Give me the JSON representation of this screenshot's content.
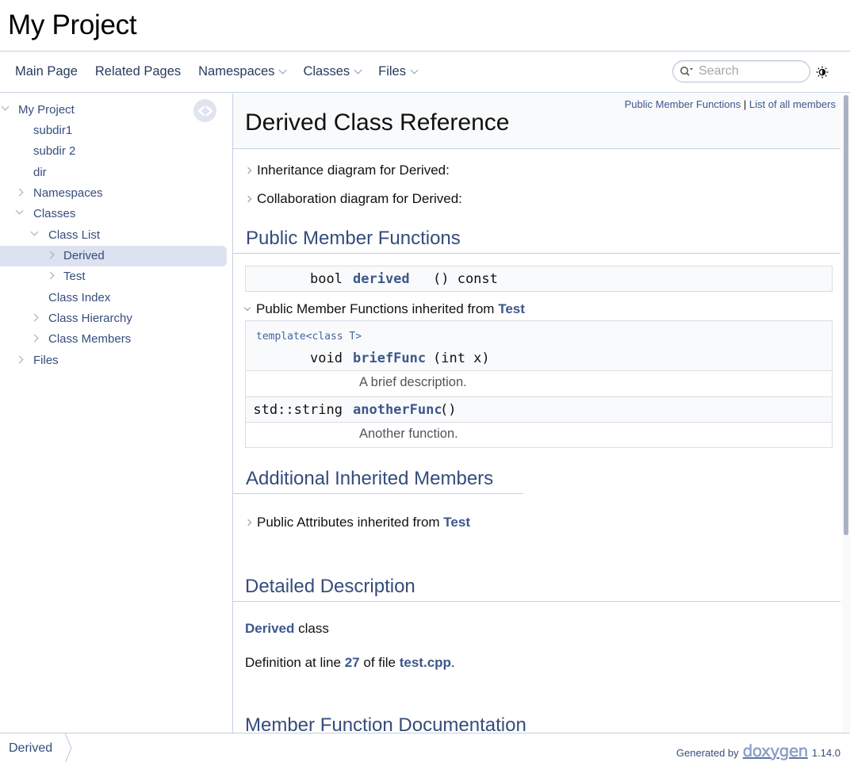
{
  "project": {
    "name": "My Project"
  },
  "nav": {
    "items": [
      {
        "label": "Main Page",
        "dropdown": false
      },
      {
        "label": "Related Pages",
        "dropdown": false
      },
      {
        "label": "Namespaces",
        "dropdown": true
      },
      {
        "label": "Classes",
        "dropdown": true
      },
      {
        "label": "Files",
        "dropdown": true
      }
    ],
    "search_placeholder": "Search"
  },
  "tree": {
    "items": [
      {
        "label": "My Project",
        "expanded": true
      },
      {
        "label": "subdir1"
      },
      {
        "label": "subdir 2"
      },
      {
        "label": "dir"
      },
      {
        "label": "Namespaces",
        "expanded": false
      },
      {
        "label": "Classes",
        "expanded": true
      },
      {
        "label": "Class List",
        "expanded": true
      },
      {
        "label": "Derived",
        "expanded": false,
        "selected": true
      },
      {
        "label": "Test",
        "expanded": false
      },
      {
        "label": "Class Index"
      },
      {
        "label": "Class Hierarchy",
        "expanded": false
      },
      {
        "label": "Class Members",
        "expanded": false
      },
      {
        "label": "Files",
        "expanded": false
      }
    ]
  },
  "header": {
    "summary_link1": "Public Member Functions",
    "summary_sep": "|",
    "summary_link2": "List of all members",
    "title": "Derived Class Reference"
  },
  "diagrams": {
    "inheritance": "Inheritance diagram for Derived:",
    "collaboration": "Collaboration diagram for Derived:"
  },
  "public_member_functions": {
    "heading": "Public Member Functions",
    "own": [
      {
        "type": "bool",
        "name": "derived",
        "args": "() const"
      }
    ],
    "inherited_label": "Public Member Functions inherited from",
    "inherited_from": "Test",
    "inherited": [
      {
        "template": "template<class T>",
        "type": "void",
        "name": "briefFunc",
        "args": "(int x)",
        "desc": "A brief description."
      },
      {
        "type": "std::string",
        "name": "anotherFunc",
        "args": "()",
        "desc": "Another function."
      }
    ]
  },
  "additional": {
    "heading": "Additional Inherited Members",
    "attrs_label": "Public Attributes inherited from",
    "attrs_from": "Test"
  },
  "detailed": {
    "heading": "Detailed Description",
    "class_link": "Derived",
    "class_text": "class",
    "def_prefix": "Definition at line",
    "def_line": "27",
    "def_mid": "of file",
    "def_file": "test.cpp",
    "def_suffix": "."
  },
  "member_doc": {
    "heading": "Member Function Documentation"
  },
  "footer": {
    "breadcrumb": "Derived",
    "generated_by": "Generated by",
    "logo_text": "doxygen",
    "version": "1.14.0"
  },
  "colors": {
    "link": "#3d578c",
    "heading": "#354c7b",
    "border": "#c4cfe5",
    "selected_bg": "#dce2ef"
  }
}
